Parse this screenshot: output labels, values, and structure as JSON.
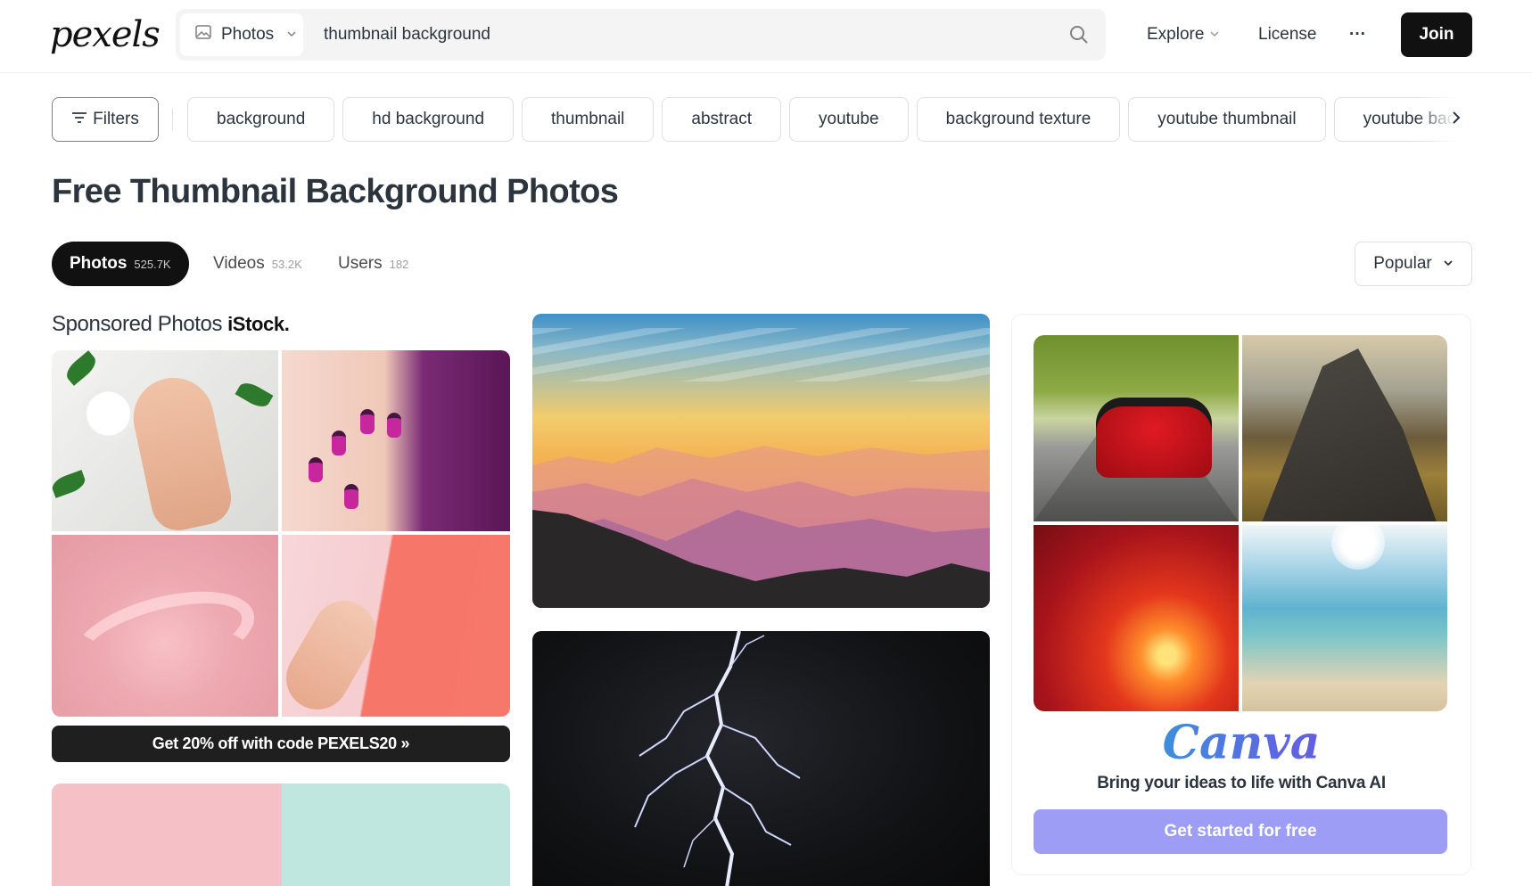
{
  "header": {
    "logo": "pexels",
    "search": {
      "type_label": "Photos",
      "query": "thumbnail background"
    },
    "nav": {
      "explore": "Explore",
      "license": "License",
      "more": "···",
      "join": "Join"
    }
  },
  "filters_label": "Filters",
  "chips": [
    "background",
    "hd background",
    "thumbnail",
    "abstract",
    "youtube",
    "background texture",
    "youtube thumbnail",
    "youtube background"
  ],
  "page_title": "Free Thumbnail Background Photos",
  "tabs": [
    {
      "label": "Photos",
      "count": "525.7K"
    },
    {
      "label": "Videos",
      "count": "53.2K"
    },
    {
      "label": "Users",
      "count": "182"
    }
  ],
  "sort_label": "Popular",
  "sponsored": {
    "title": "Sponsored Photos",
    "brand": "iStock.",
    "promo": "Get 20% off with code PEXELS20 »"
  },
  "canva": {
    "logo": "Canva",
    "tagline": "Bring your ideas to life with Canva AI",
    "cta": "Get started for free"
  },
  "colors": {
    "primary": "#111111",
    "text": "#2c343e",
    "canva_cta": "#9d9df5"
  }
}
